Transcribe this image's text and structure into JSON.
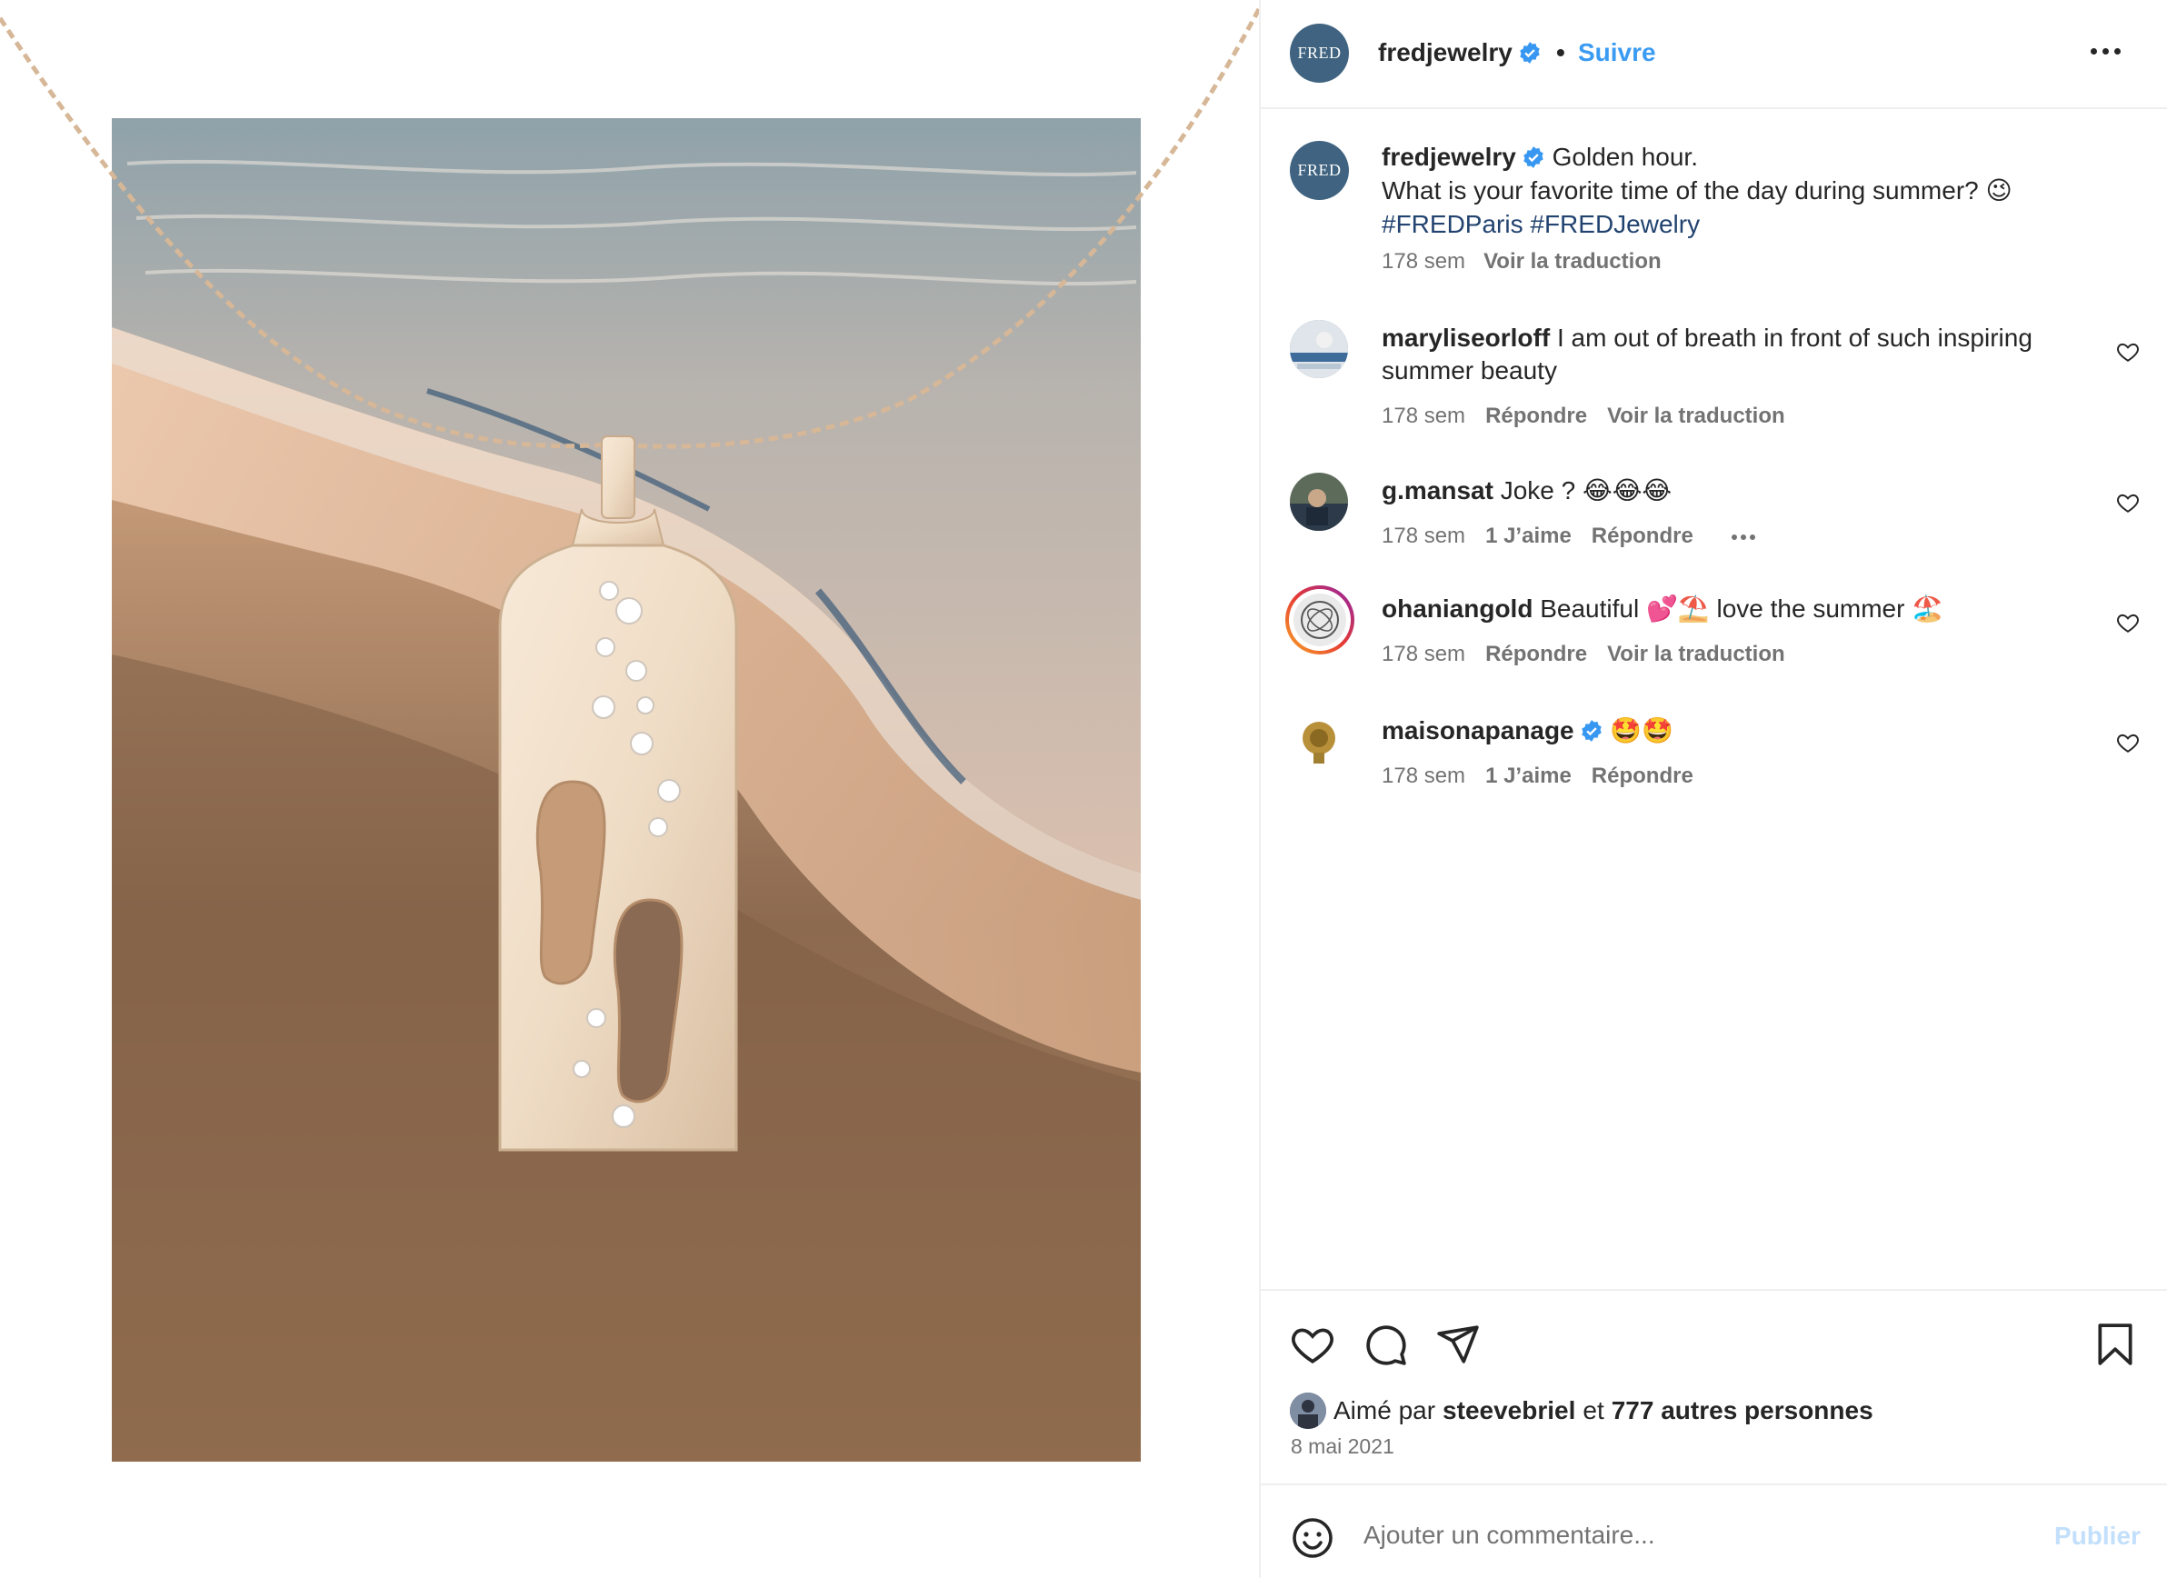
{
  "post": {
    "author": "fredjewelry",
    "avatar_text": "FRED",
    "follow_label": "Suivre",
    "dot": "•",
    "caption_line1": "Golden hour.",
    "caption_line2": "What is your favorite time of the day during summer? 😉",
    "hashtags": "#FREDParis #FREDJewelry",
    "caption_time": "178 sem",
    "see_translation": "Voir la traduction"
  },
  "comments": [
    {
      "user": "maryliseorloff",
      "text": "I am out of breath in front of such inspiring summer beauty",
      "time": "178 sem",
      "likes": "",
      "reply": "Répondre",
      "translate": "Voir la traduction"
    },
    {
      "user": "g.mansat",
      "text": "Joke ? 😂😂😂",
      "time": "178 sem",
      "likes": "1 J’aime",
      "reply": "Répondre",
      "translate": ""
    },
    {
      "user": "ohaniangold",
      "text": "Beautiful 💕⛱️  love the summer  🏖️",
      "time": "178 sem",
      "likes": "",
      "reply": "Répondre",
      "translate": "Voir la traduction"
    },
    {
      "user": "maisonapanage",
      "text": "🤩🤩",
      "time": "178 sem",
      "likes": "1 J’aime",
      "reply": "Répondre",
      "translate": ""
    }
  ],
  "likes": {
    "prefix": "Aimé par",
    "user": "steevebriel",
    "middle": "et",
    "others": "777 autres personnes"
  },
  "date": "8 mai 2021",
  "comment_box": {
    "placeholder": "Ajouter un commentaire...",
    "publish": "Publier"
  },
  "icons": {
    "more": "more-options-icon",
    "like": "heart-icon",
    "comment": "comment-icon",
    "share": "paper-plane-icon",
    "save": "bookmark-icon",
    "emoji": "smiley-icon",
    "verified": "verified-badge-icon"
  },
  "colors": {
    "follow": "#3b9bf2",
    "hashtag": "#224370",
    "secondary_text": "#737373",
    "publish_disabled": "#c2dffb",
    "verified": "#3897f0",
    "fred_avatar": "#3f6380"
  }
}
